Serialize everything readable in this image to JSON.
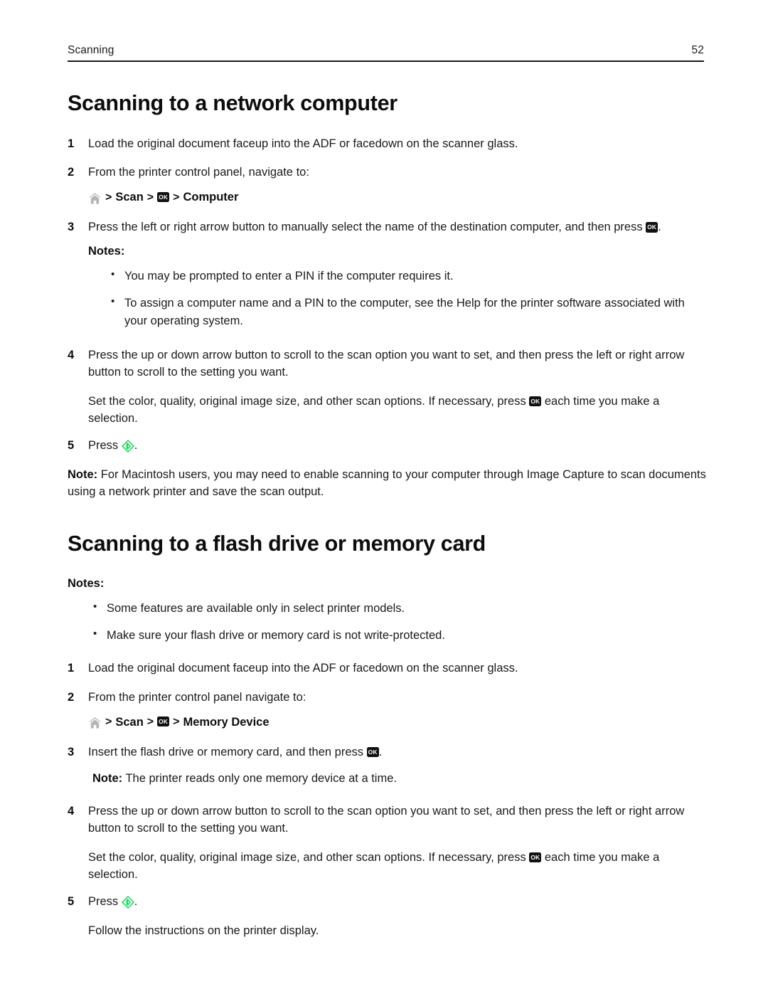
{
  "header": {
    "running_title": "Scanning",
    "page_number": "52"
  },
  "icons": {
    "home": "home-icon",
    "ok": "ok-button-icon",
    "ok_label": "OK",
    "start": "start-button-icon"
  },
  "colors": {
    "text": "#1a1a1a",
    "heading": "#0d0d0d",
    "ok_button_bg": "#111111",
    "ok_button_fg": "#ffffff",
    "start_green": "#1ed760",
    "home_gray": "#b3b3b3",
    "rule": "#1a1a1a"
  },
  "sections": [
    {
      "title": "Scanning to a network computer",
      "steps": [
        {
          "number": "1",
          "text": "Load the original document faceup into the ADF or facedown on the scanner glass."
        },
        {
          "number": "2",
          "text": "From the printer control panel, navigate to:"
        },
        {
          "number": "3",
          "text_before_icon": "Press the left or right arrow button to manually select the name of the destination computer, and then press ",
          "text_after_icon": "."
        },
        {
          "number": "4",
          "text": "Press the up or down arrow button to scroll to the scan option you want to set, and then press the left or right arrow button to scroll to the setting you want.",
          "continuation_before_icon": "Set the color, quality, original image size, and other scan options. If necessary, press ",
          "continuation_after_icon": " each time you make a selection."
        },
        {
          "number": "5",
          "text_before_icon": "Press ",
          "text_after_icon": "."
        }
      ],
      "nav_path": {
        "home": "home-icon",
        "sep1": ">",
        "scan": "Scan",
        "sep2": ">",
        "ok": "OK",
        "sep3": ">",
        "destination": "Computer"
      },
      "notes_label": "Notes:",
      "notes": [
        "You may be prompted to enter a PIN if the computer requires it.",
        "To assign a computer name and a PIN to the computer, see the Help for the printer software associated with your operating system."
      ],
      "closing_note": {
        "label": "Note:",
        "text": " For Macintosh users, you may need to enable scanning to your computer through Image Capture to scan documents using a network printer and save the scan output."
      }
    },
    {
      "title": "Scanning to a flash drive or memory card",
      "notes_label": "Notes:",
      "notes": [
        "Some features are available only in select printer models.",
        "Make sure your flash drive or memory card is not write-protected."
      ],
      "steps": [
        {
          "number": "1",
          "text": "Load the original document faceup into the ADF or facedown on the scanner glass."
        },
        {
          "number": "2",
          "text": "From the printer control panel navigate to:"
        },
        {
          "number": "3",
          "text_before_icon": "Insert the flash drive or memory card, and then press ",
          "text_after_icon": ".",
          "sub_note_label": "Note:",
          "sub_note_text": " The printer reads only one memory device at a time."
        },
        {
          "number": "4",
          "text": "Press the up or down arrow button to scroll to the scan option you want to set, and then press the left or right arrow button to scroll to the setting you want.",
          "continuation_before_icon": "Set the color, quality, original image size, and other scan options. If necessary, press ",
          "continuation_after_icon": " each time you make a selection."
        },
        {
          "number": "5",
          "text_before_icon": "Press ",
          "text_after_icon": ".",
          "follow_up": "Follow the instructions on the printer display."
        }
      ],
      "nav_path": {
        "home": "home-icon",
        "sep1": ">",
        "scan": "Scan",
        "sep2": ">",
        "ok": "OK",
        "sep3": ">",
        "destination": "Memory Device"
      }
    }
  ]
}
